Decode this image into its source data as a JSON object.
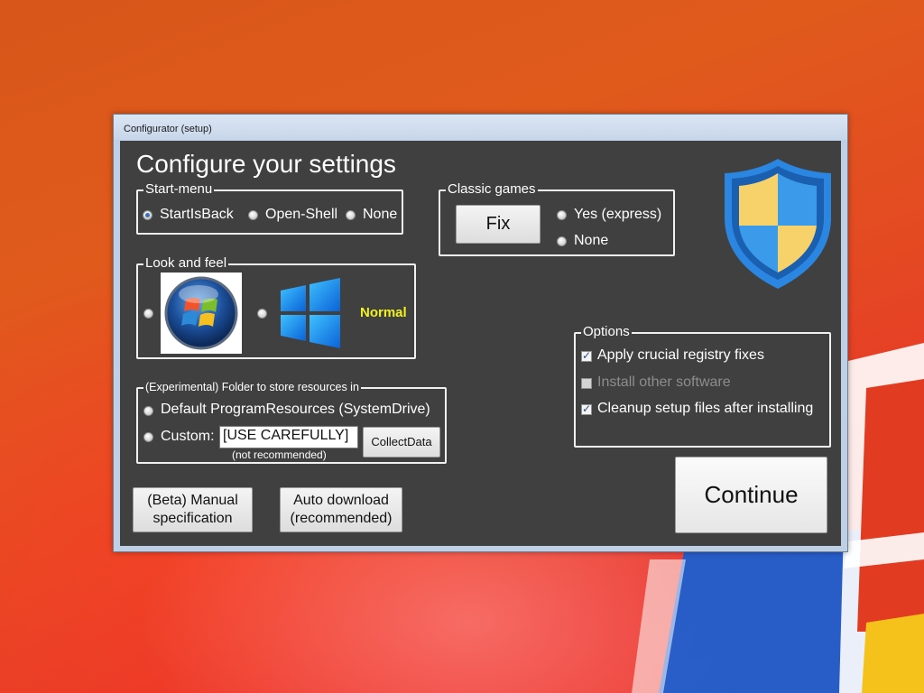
{
  "window": {
    "title": "Configurator (setup)"
  },
  "heading": "Configure your settings",
  "start_menu": {
    "legend": "Start-menu",
    "options": [
      {
        "label": "StartIsBack",
        "selected": true
      },
      {
        "label": "Open-Shell",
        "selected": false
      },
      {
        "label": "None",
        "selected": false
      }
    ]
  },
  "classic_games": {
    "legend": "Classic games",
    "fix_label": "Fix",
    "options": [
      {
        "label": "Yes (express)",
        "selected": false
      },
      {
        "label": "None",
        "selected": false
      }
    ]
  },
  "look_and_feel": {
    "legend": "Look and feel",
    "option1_icon": "windows-7-orb-icon",
    "option2_icon": "windows-11-logo-icon",
    "option2_label": "Normal",
    "label_color": "#f2f21a"
  },
  "folder": {
    "legend": "(Experimental) Folder to store resources in",
    "default_label": "Default ProgramResources (SystemDrive)",
    "custom_label": "Custom:",
    "custom_value": "[USE CAREFULLY]",
    "collect_label": "CollectData",
    "note": "(not recommended)"
  },
  "options": {
    "legend": "Options",
    "items": [
      {
        "label": "Apply crucial registry fixes",
        "checked": true,
        "enabled": true
      },
      {
        "label": "Install other software",
        "checked": false,
        "enabled": false
      },
      {
        "label": "Cleanup setup files after installing",
        "checked": true,
        "enabled": true
      }
    ]
  },
  "buttons": {
    "manual_line1": "(Beta) Manual",
    "manual_line2": "specification",
    "auto_line1": "Auto download",
    "auto_line2": "(recommended)",
    "continue": "Continue"
  },
  "shield_icon": "uac-shield-icon",
  "colors": {
    "panel_bg": "#404040",
    "shield_blue": "#1f73c9",
    "shield_yellow": "#f7d26a",
    "desktop_red": "#e44a22"
  }
}
